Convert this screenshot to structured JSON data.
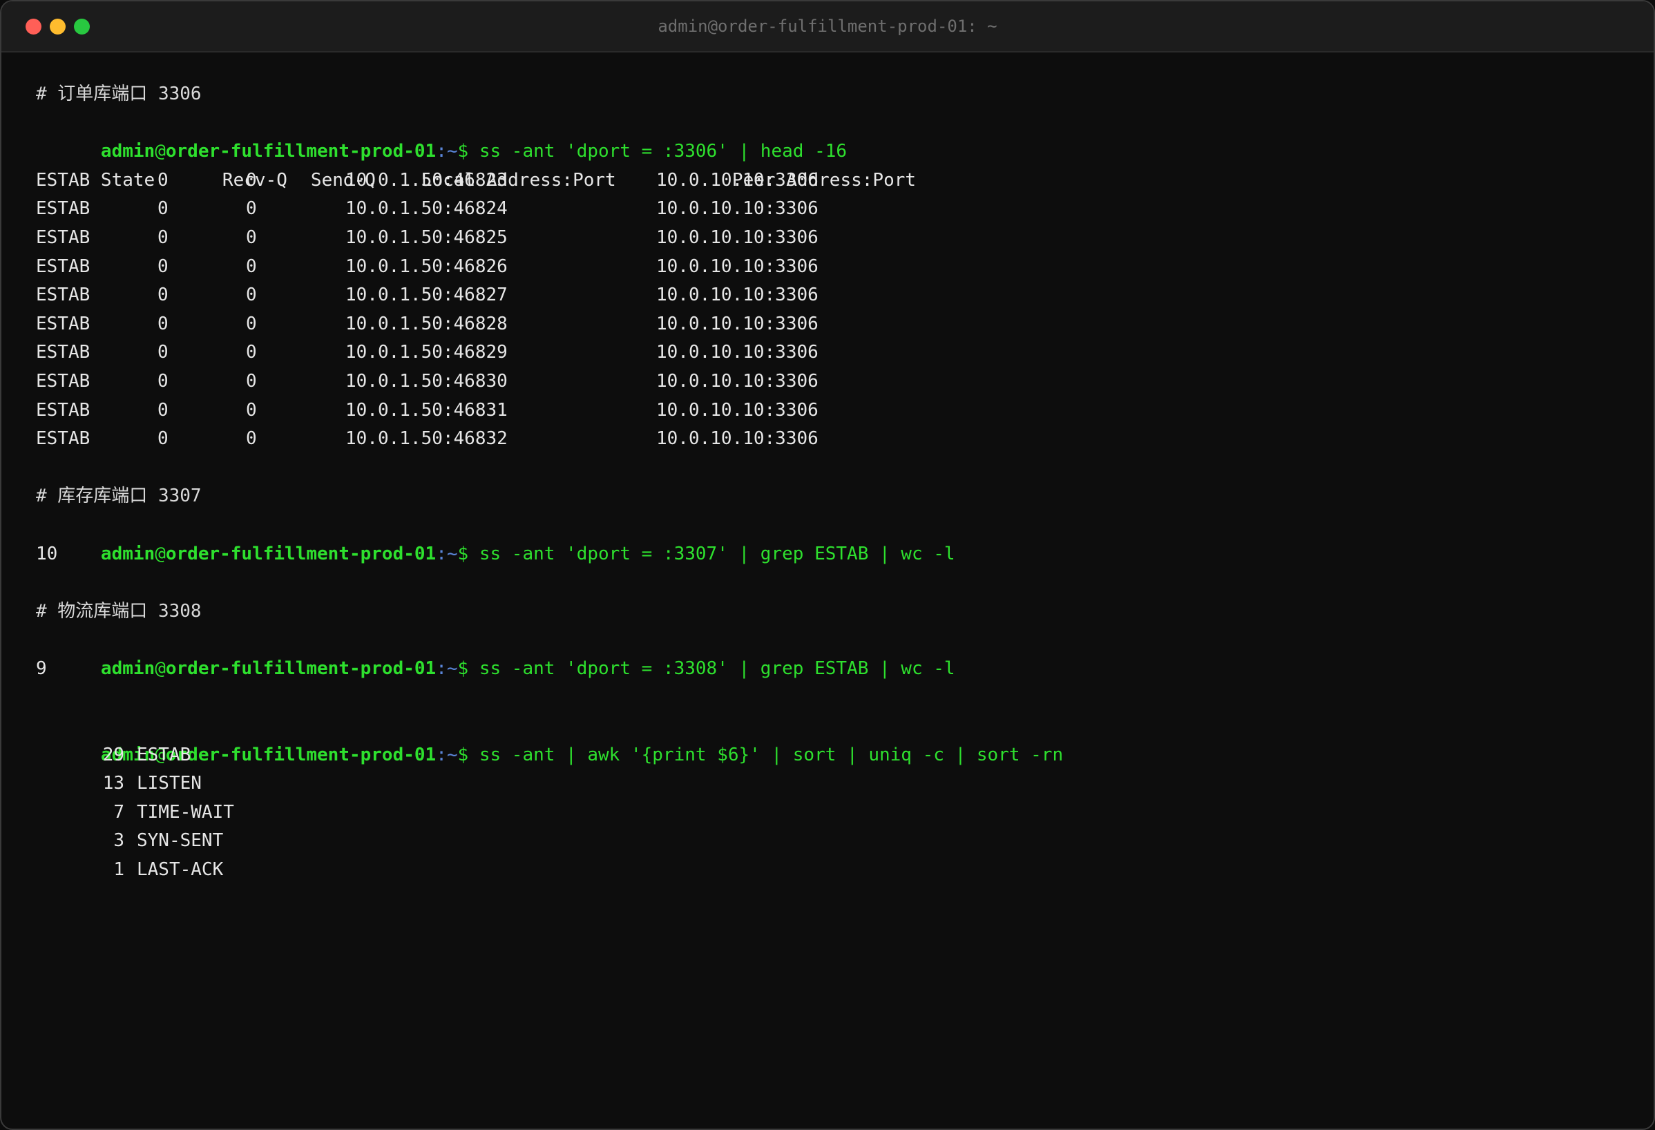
{
  "window": {
    "title": "admin@order-fulfillment-prod-01: ~"
  },
  "prompt": {
    "user": "admin",
    "at": "@",
    "host": "order-fulfillment-prod-01",
    "path": ":~",
    "dollar": "$"
  },
  "block1": {
    "comment": "# 订单库端口 3306",
    "command": " ss -ant 'dport = :3306' | head -16",
    "headers": [
      "State",
      "Recv-Q",
      "Send-Q",
      "Local Address:Port",
      "Peer Address:Port"
    ],
    "rows": [
      [
        "ESTAB",
        "0",
        "0",
        "10.0.1.50:46823",
        "10.0.10.10:3306"
      ],
      [
        "ESTAB",
        "0",
        "0",
        "10.0.1.50:46824",
        "10.0.10.10:3306"
      ],
      [
        "ESTAB",
        "0",
        "0",
        "10.0.1.50:46825",
        "10.0.10.10:3306"
      ],
      [
        "ESTAB",
        "0",
        "0",
        "10.0.1.50:46826",
        "10.0.10.10:3306"
      ],
      [
        "ESTAB",
        "0",
        "0",
        "10.0.1.50:46827",
        "10.0.10.10:3306"
      ],
      [
        "ESTAB",
        "0",
        "0",
        "10.0.1.50:46828",
        "10.0.10.10:3306"
      ],
      [
        "ESTAB",
        "0",
        "0",
        "10.0.1.50:46829",
        "10.0.10.10:3306"
      ],
      [
        "ESTAB",
        "0",
        "0",
        "10.0.1.50:46830",
        "10.0.10.10:3306"
      ],
      [
        "ESTAB",
        "0",
        "0",
        "10.0.1.50:46831",
        "10.0.10.10:3306"
      ],
      [
        "ESTAB",
        "0",
        "0",
        "10.0.1.50:46832",
        "10.0.10.10:3306"
      ]
    ]
  },
  "block2": {
    "comment": "# 库存库端口 3307",
    "command": " ss -ant 'dport = :3307' | grep ESTAB | wc -l",
    "output": "10"
  },
  "block3": {
    "comment": "# 物流库端口 3308",
    "command": " ss -ant 'dport = :3308' | grep ESTAB | wc -l",
    "output": "9"
  },
  "block4": {
    "command": " ss -ant | awk '{print $6}' | sort | uniq -c | sort -rn",
    "rows": [
      {
        "count": "29",
        "state": "ESTAB"
      },
      {
        "count": "13",
        "state": "LISTEN"
      },
      {
        "count": "7",
        "state": "TIME-WAIT"
      },
      {
        "count": "3",
        "state": "SYN-SENT"
      },
      {
        "count": "1",
        "state": "LAST-ACK"
      }
    ]
  }
}
